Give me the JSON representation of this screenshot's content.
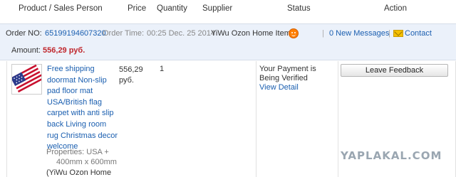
{
  "header": {
    "product": "Product / Sales Person",
    "price": "Price",
    "quantity": "Quantity",
    "supplier": "Supplier",
    "status": "Status",
    "action": "Action"
  },
  "order": {
    "number_label": "Order NO:",
    "number": "65199194607320",
    "time_label": "Order Time:",
    "time": "00:25 Dec. 25 2014",
    "supplier": "YiWu Ozon Home Items",
    "sep1": "|",
    "new_messages": "0 New Messages",
    "sep2": "|",
    "contact": "Contact",
    "amount_label": "Amount:",
    "amount": "556,29 руб."
  },
  "item": {
    "title": "Free shipping doormat Non-slip pad floor mat USA/British flag carpet with anti slip back Living room rug Christmas decor welcome",
    "properties_line1": "Properties: USA  +",
    "properties_line2": "400mm x 600mm",
    "supplier_paren": "(YiWu Ozon Home",
    "price": "556,29 руб.",
    "quantity": "1",
    "status": "Your Payment is Being Verified",
    "view_detail": "View Detail",
    "leave_feedback": "Leave Feedback"
  },
  "icons": {
    "supplier_badge": "smiley-face-icon",
    "contact": "envelope-icon",
    "thumbnail": "us-flag-doormat-image"
  },
  "colors": {
    "link": "#1b5fb0",
    "amount": "#c0272d",
    "band": "#ebf1fa"
  },
  "watermark": "YAPLAKAL.COM"
}
